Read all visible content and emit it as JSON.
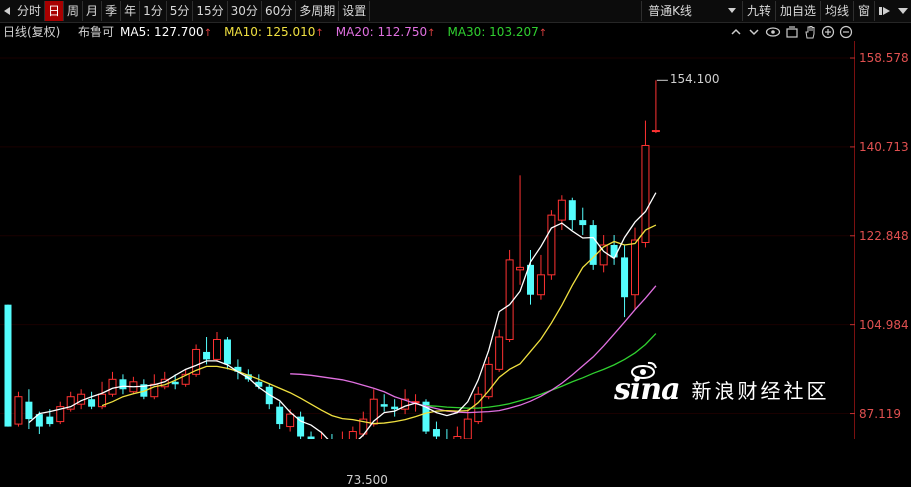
{
  "toolbar": {
    "periods": [
      "分时",
      "日",
      "周",
      "月",
      "季",
      "年",
      "1分",
      "5分",
      "15分",
      "30分",
      "60分",
      "多周期",
      "设置"
    ],
    "active_period": "日",
    "chart_type": "普通K线",
    "right_buttons": [
      "九转",
      "加自选",
      "均线",
      "窗"
    ]
  },
  "info": {
    "mode": "日线(复权)",
    "name": "布鲁可",
    "ma": [
      {
        "label": "MA5: 127.700",
        "color": "#ffffff"
      },
      {
        "label": "MA10: 125.010",
        "color": "#f0e040"
      },
      {
        "label": "MA20: 112.750",
        "color": "#e070e0"
      },
      {
        "label": "MA30: 103.207",
        "color": "#30d030"
      }
    ]
  },
  "colors": {
    "up": "#ff3232",
    "down": "#54fcfc",
    "axis": "#e05050"
  },
  "watermark": {
    "logo": "sina",
    "text": "新浪财经社区"
  },
  "chart_data": {
    "type": "candlestick",
    "price_axis_labels": [
      "158.578",
      "140.713",
      "122.848",
      "104.984",
      "87.119"
    ],
    "ylim": [
      82,
      162
    ],
    "annotations": [
      {
        "label": "154.100",
        "value": 154.1,
        "index": 62
      },
      {
        "label": "73.500",
        "value": 73.5,
        "index": 31
      }
    ],
    "candles": [
      [
        109,
        84.5,
        109,
        84.5
      ],
      [
        85,
        90.5,
        91.5,
        84.5
      ],
      [
        89.5,
        86,
        92,
        84
      ],
      [
        87,
        84.5,
        87.5,
        83
      ],
      [
        86.5,
        85,
        88,
        84.5
      ],
      [
        85.5,
        88.5,
        89.5,
        85
      ],
      [
        88,
        90.5,
        91.5,
        87.5
      ],
      [
        89,
        91,
        92,
        88
      ],
      [
        90,
        88.5,
        91.5,
        88
      ],
      [
        88.5,
        91,
        93.5,
        88
      ],
      [
        91,
        94,
        95.5,
        90.5
      ],
      [
        94,
        92,
        95,
        91
      ],
      [
        91.5,
        93.5,
        94.5,
        91
      ],
      [
        93,
        90.5,
        94,
        90
      ],
      [
        90.5,
        93,
        95,
        90
      ],
      [
        92.5,
        94,
        95.5,
        92
      ],
      [
        93.5,
        93,
        95,
        92
      ],
      [
        93,
        95,
        96,
        92.5
      ],
      [
        95,
        100,
        101,
        94.5
      ],
      [
        99.5,
        98,
        102.5,
        97
      ],
      [
        98,
        102,
        103.5,
        97.5
      ],
      [
        102,
        97,
        102.5,
        96
      ],
      [
        96.5,
        95.5,
        98,
        94
      ],
      [
        95,
        94,
        96,
        93.5
      ],
      [
        93.5,
        92.5,
        95,
        92
      ],
      [
        92.5,
        89,
        93,
        88
      ],
      [
        88.5,
        85,
        89.5,
        84
      ],
      [
        84.5,
        87,
        88,
        83.5
      ],
      [
        86.5,
        82.5,
        87.5,
        82
      ],
      [
        82.5,
        80.5,
        83.5,
        79
      ],
      [
        80,
        81.5,
        83.5,
        79.5
      ],
      [
        81,
        78,
        83,
        74
      ],
      [
        78,
        81,
        83.5,
        77.5
      ],
      [
        81,
        83.5,
        84.5,
        80
      ],
      [
        83,
        86,
        87.5,
        82.5
      ],
      [
        85,
        90,
        92,
        84.5
      ],
      [
        89,
        88.5,
        91,
        87.5
      ],
      [
        88.5,
        88,
        90,
        86.5
      ],
      [
        88,
        90,
        92,
        87
      ],
      [
        89.5,
        89.5,
        91,
        87.5
      ],
      [
        89.5,
        83.5,
        90,
        83
      ],
      [
        84,
        82.5,
        85.5,
        81.5
      ],
      [
        82,
        81,
        84,
        80
      ],
      [
        80.5,
        82.5,
        84.5,
        80
      ],
      [
        82,
        86,
        88,
        81.5
      ],
      [
        85.5,
        91,
        92.5,
        85
      ],
      [
        90.5,
        97,
        98.5,
        90
      ],
      [
        96,
        102.5,
        104,
        95.5
      ],
      [
        102,
        118,
        120,
        101.5
      ],
      [
        116,
        116.5,
        135,
        113
      ],
      [
        117,
        111,
        120,
        109
      ],
      [
        111,
        115,
        119,
        110
      ],
      [
        115,
        127,
        128,
        114
      ],
      [
        126,
        130,
        131,
        124
      ],
      [
        130,
        126,
        130.5,
        124
      ],
      [
        126,
        125,
        128.5,
        123
      ],
      [
        125,
        117,
        126,
        116
      ],
      [
        117,
        121,
        123,
        115.5
      ],
      [
        121,
        118.5,
        123,
        117
      ],
      [
        118.5,
        110.5,
        121,
        106.5
      ],
      [
        111,
        122,
        124.5,
        108
      ],
      [
        121.5,
        141,
        146,
        120.5
      ],
      [
        144,
        144,
        154.1,
        143.5
      ]
    ],
    "ma5": [
      85.3,
      87.1,
      87.5,
      88.0,
      88.5,
      89.7,
      90.5,
      91.2,
      92.2,
      92.6,
      92.5,
      92.6,
      92.9,
      93.5,
      94.8,
      96.0,
      96.8,
      97.7,
      97.7,
      96.9,
      95.5,
      94.3,
      92.4,
      90.9,
      89.7,
      87.4,
      85.6,
      84.8,
      83.3,
      81.1,
      80.3,
      80.8,
      82.8,
      85.6,
      87.3,
      87.6,
      88.6,
      89.2,
      88.4,
      87.3,
      86.7,
      87.3,
      89.5,
      93.9,
      99.8,
      107.6,
      109.0,
      111.7,
      117.6,
      120.7,
      124.4,
      125.4,
      123.8,
      122.4,
      122.5,
      119.7,
      118.3,
      122.5,
      125.6,
      127.7,
      131.5
    ],
    "ma10": [
      88.7,
      89.5,
      90.5,
      91.1,
      91.6,
      92.5,
      92.9,
      93.8,
      94.8,
      95.8,
      96.6,
      96.6,
      96.2,
      95.6,
      94.8,
      94.0,
      93.1,
      92.2,
      91.3,
      90.2,
      89.0,
      87.8,
      86.7,
      86.1,
      85.9,
      85.5,
      85.1,
      85.2,
      85.5,
      85.9,
      86.5,
      87.2,
      87.6,
      87.7,
      87.6,
      87.7,
      89.3,
      91.7,
      94.4,
      96.0,
      97.1,
      99.6,
      102.1,
      105.3,
      108.9,
      112.9,
      116.5,
      118.5,
      120.6,
      121.7,
      121.0,
      121.3,
      124.0,
      125.0
    ],
    "ma20": [
      95.1,
      95.0,
      94.8,
      94.5,
      94.2,
      93.9,
      93.4,
      92.8,
      92.2,
      91.5,
      90.5,
      89.8,
      89.1,
      88.6,
      88.1,
      87.6,
      87.4,
      87.3,
      87.4,
      87.5,
      87.7,
      88.2,
      88.8,
      89.6,
      90.6,
      91.8,
      93.2,
      94.9,
      96.7,
      98.5,
      100.7,
      103.1,
      105.5,
      108.0,
      110.3,
      112.8
    ],
    "ma30": [
      88.7,
      88.6,
      88.4,
      88.3,
      88.2,
      88.2,
      88.4,
      88.7,
      89.1,
      89.7,
      90.3,
      91.0,
      91.8,
      92.6,
      93.5,
      94.3,
      95.2,
      96.0,
      96.9,
      98.0,
      99.3,
      101.0,
      103.2
    ]
  }
}
